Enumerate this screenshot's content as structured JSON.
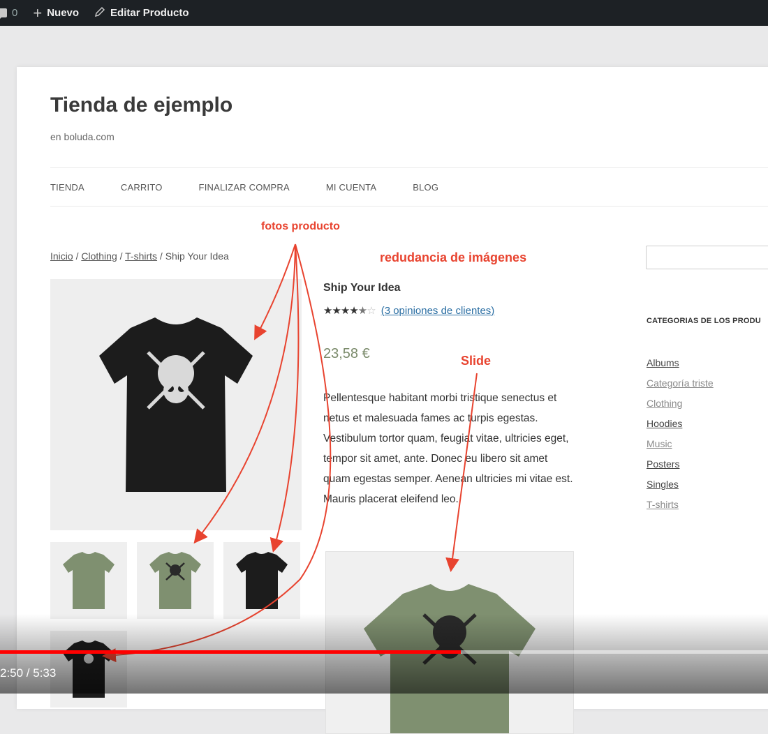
{
  "admin_bar": {
    "comments_count": "0",
    "new_label": "Nuevo",
    "edit_label": "Editar Producto"
  },
  "site": {
    "title": "Tienda de ejemplo",
    "tagline": "en boluda.com"
  },
  "nav": [
    "TIENDA",
    "CARRITO",
    "FINALIZAR COMPRA",
    "MI CUENTA",
    "BLOG"
  ],
  "breadcrumb": {
    "home": "Inicio",
    "sep": " / ",
    "cat1": "Clothing",
    "cat2": "T-shirts",
    "current": "Ship Your Idea"
  },
  "product": {
    "title": "Ship Your Idea",
    "rating": 4.5,
    "stars_full": "★★★★",
    "stars_half": "★",
    "stars_empty": "☆",
    "reviews_link": "(3 opiniones de clientes)",
    "price": "23,58 €",
    "description": "Pellentesque habitant morbi tristique senectus et netus et malesuada fames ac turpis egestas. Vestibulum tortor quam, feugiat vitae, ultricies eget, tempor sit amet, ante. Donec eu libero sit amet quam egestas semper. Aenean ultricies mi vitae est. Mauris placerat eleifend leo."
  },
  "sidebar": {
    "categories_title": "CATEGORIAS DE LOS PRODU",
    "categories": [
      "Albums",
      "Categoría triste",
      "Clothing",
      "Hoodies",
      "Music",
      "Posters",
      "Singles",
      "T-shirts"
    ]
  },
  "annotations": {
    "fotos": "fotos producto",
    "redundancia": "redudancia de imágenes",
    "slide": "Slide"
  },
  "video": {
    "timecode": "2:50 / 5:33",
    "progress": 0.6
  },
  "colors": {
    "annotation": "#e8432f",
    "shirt_black": "#1c1c1c",
    "shirt_green": "#7f9070",
    "admin_bar": "#1d2125"
  }
}
